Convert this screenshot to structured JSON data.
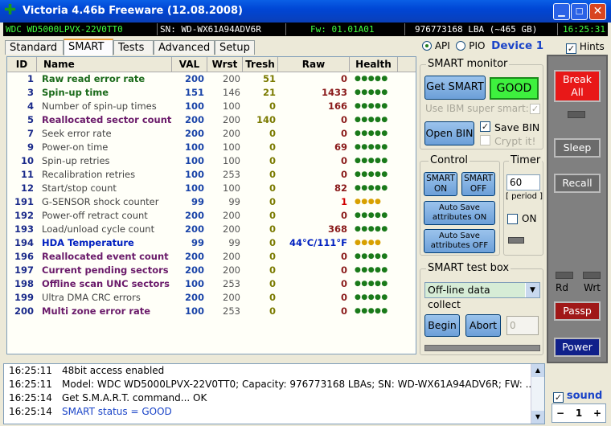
{
  "window": {
    "title": "Victoria 4.46b Freeware (12.08.2008)"
  },
  "info": {
    "model": "WDC WD5000LPVX-22V0TT0",
    "serial": "SN: WD-WX61A94ADV6R",
    "firmware": "Fw: 01.01A01",
    "lba": "976773168 LBA (~465 GB)",
    "time": "16:25:31"
  },
  "tabs": [
    "Standard",
    "SMART",
    "Tests",
    "Advanced",
    "Setup"
  ],
  "device": {
    "api_label": "API",
    "pio_label": "PIO",
    "device_label": "Device 1",
    "hints_label": "Hints"
  },
  "table": {
    "headers": [
      "ID",
      "Name",
      "VAL",
      "Wrst",
      "Tresh",
      "Raw",
      "Health"
    ],
    "rows": [
      {
        "id": "1",
        "name": "Raw read error rate",
        "val": "200",
        "wrst": "200",
        "tresh": "51",
        "raw": "0",
        "health": "●●●●●",
        "hcolor": "#1a7a1a",
        "ncolor": "#1a6a1a",
        "bold": true
      },
      {
        "id": "3",
        "name": "Spin-up time",
        "val": "151",
        "wrst": "146",
        "tresh": "21",
        "raw": "1433",
        "health": "●●●●●",
        "hcolor": "#1a7a1a",
        "ncolor": "#1a6a1a",
        "bold": true
      },
      {
        "id": "4",
        "name": "Number of spin-up times",
        "val": "100",
        "wrst": "100",
        "tresh": "0",
        "raw": "166",
        "health": "●●●●●",
        "hcolor": "#1a7a1a",
        "ncolor": "#444",
        "bold": false
      },
      {
        "id": "5",
        "name": "Reallocated sector count",
        "val": "200",
        "wrst": "200",
        "tresh": "140",
        "raw": "0",
        "health": "●●●●●",
        "hcolor": "#1a7a1a",
        "ncolor": "#6a1a6a",
        "bold": true
      },
      {
        "id": "7",
        "name": "Seek error rate",
        "val": "200",
        "wrst": "200",
        "tresh": "0",
        "raw": "0",
        "health": "●●●●●",
        "hcolor": "#1a7a1a",
        "ncolor": "#444",
        "bold": false
      },
      {
        "id": "9",
        "name": "Power-on time",
        "val": "100",
        "wrst": "100",
        "tresh": "0",
        "raw": "69",
        "health": "●●●●●",
        "hcolor": "#1a7a1a",
        "ncolor": "#444",
        "bold": false
      },
      {
        "id": "10",
        "name": "Spin-up retries",
        "val": "100",
        "wrst": "100",
        "tresh": "0",
        "raw": "0",
        "health": "●●●●●",
        "hcolor": "#1a7a1a",
        "ncolor": "#444",
        "bold": false
      },
      {
        "id": "11",
        "name": "Recalibration retries",
        "val": "100",
        "wrst": "253",
        "tresh": "0",
        "raw": "0",
        "health": "●●●●●",
        "hcolor": "#1a7a1a",
        "ncolor": "#444",
        "bold": false
      },
      {
        "id": "12",
        "name": "Start/stop count",
        "val": "100",
        "wrst": "100",
        "tresh": "0",
        "raw": "82",
        "health": "●●●●●",
        "hcolor": "#1a7a1a",
        "ncolor": "#444",
        "bold": false
      },
      {
        "id": "191",
        "name": "G-SENSOR shock counter",
        "val": "99",
        "wrst": "99",
        "tresh": "0",
        "raw": "1",
        "health": "●●●●",
        "hcolor": "#d8a000",
        "ncolor": "#444",
        "bold": false,
        "rawcolor": "#d00000"
      },
      {
        "id": "192",
        "name": "Power-off retract count",
        "val": "200",
        "wrst": "200",
        "tresh": "0",
        "raw": "0",
        "health": "●●●●●",
        "hcolor": "#1a7a1a",
        "ncolor": "#444",
        "bold": false
      },
      {
        "id": "193",
        "name": "Load/unload cycle count",
        "val": "200",
        "wrst": "200",
        "tresh": "0",
        "raw": "368",
        "health": "●●●●●",
        "hcolor": "#1a7a1a",
        "ncolor": "#444",
        "bold": false
      },
      {
        "id": "194",
        "name": "HDA Temperature",
        "val": "99",
        "wrst": "99",
        "tresh": "0",
        "raw": "44°C/111°F",
        "health": "●●●●",
        "hcolor": "#d8a000",
        "ncolor": "#0020c0",
        "bold": true,
        "rawcolor": "#0020c0"
      },
      {
        "id": "196",
        "name": "Reallocated event count",
        "val": "200",
        "wrst": "200",
        "tresh": "0",
        "raw": "0",
        "health": "●●●●●",
        "hcolor": "#1a7a1a",
        "ncolor": "#6a1a6a",
        "bold": true
      },
      {
        "id": "197",
        "name": "Current pending sectors",
        "val": "200",
        "wrst": "200",
        "tresh": "0",
        "raw": "0",
        "health": "●●●●●",
        "hcolor": "#1a7a1a",
        "ncolor": "#6a1a6a",
        "bold": true
      },
      {
        "id": "198",
        "name": "Offline scan UNC sectors",
        "val": "100",
        "wrst": "253",
        "tresh": "0",
        "raw": "0",
        "health": "●●●●●",
        "hcolor": "#1a7a1a",
        "ncolor": "#6a1a6a",
        "bold": true
      },
      {
        "id": "199",
        "name": "Ultra DMA CRC errors",
        "val": "200",
        "wrst": "200",
        "tresh": "0",
        "raw": "0",
        "health": "●●●●●",
        "hcolor": "#1a7a1a",
        "ncolor": "#444",
        "bold": false
      },
      {
        "id": "200",
        "name": "Multi zone error rate",
        "val": "100",
        "wrst": "253",
        "tresh": "0",
        "raw": "0",
        "health": "●●●●●",
        "hcolor": "#1a7a1a",
        "ncolor": "#6a1a6a",
        "bold": true
      }
    ]
  },
  "smart_monitor": {
    "title": "SMART monitor",
    "get_smart": "Get SMART",
    "status": "GOOD",
    "ibm": "Use IBM super smart:",
    "open_bin": "Open BIN",
    "save_bin": "Save BIN",
    "crypt": "Crypt it!"
  },
  "control": {
    "title": "Control",
    "smart_on": "SMART ON",
    "smart_off": "SMART OFF",
    "auto_on": "Auto Save attributes ON",
    "auto_off": "Auto Save attributes OFF"
  },
  "timer": {
    "title": "Timer",
    "value": "60",
    "period": "[ period ]",
    "on_label": "ON"
  },
  "test_box": {
    "title": "SMART test box",
    "selected": "Off-line data collect",
    "begin": "Begin",
    "abort": "Abort",
    "count": "0"
  },
  "right": {
    "break": "Break All",
    "sleep": "Sleep",
    "recall": "Recall",
    "rd": "Rd",
    "wrt": "Wrt",
    "passp": "Passp",
    "power": "Power",
    "sound": "sound",
    "stepper": "1"
  },
  "log": [
    {
      "time": "16:25:11",
      "text": "48bit access enabled",
      "color": "#000"
    },
    {
      "time": "16:25:11",
      "text": "Model: WDC WD5000LPVX-22V0TT0; Capacity: 976773168 LBAs; SN: WD-WX61A94ADV6R; FW: ...",
      "color": "#000"
    },
    {
      "time": "16:25:14",
      "text": "Get S.M.A.R.T. command... OK",
      "color": "#000"
    },
    {
      "time": "16:25:14",
      "text": "SMART status = GOOD",
      "color": "#1a44c8"
    }
  ]
}
